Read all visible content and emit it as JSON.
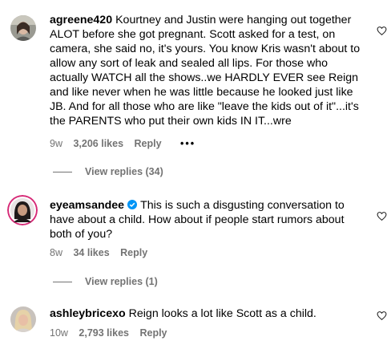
{
  "comments": [
    {
      "username": "agreene420",
      "verified": false,
      "text": "Kourtney and Justin were hanging out together ALOT before she got pregnant. Scott asked for a test, on camera, she said no, it's yours. You know Kris wasn't about to allow any sort of leak and sealed all lips. For those who actually WATCH all the shows..we HARDLY EVER see Reign and like never when he was little because he looked just like JB. And for all those who are like \"leave the kids out of it\"...it's the PARENTS who put their own kids IN IT...wre",
      "time": "9w",
      "likes": "3,206 likes",
      "reply": "Reply",
      "more": "•••",
      "view_replies": "View replies (34)"
    },
    {
      "username": "eyeamsandee",
      "verified": true,
      "text": "This is such a disgusting conversation to have about a child. How about if people start rumors about both of you?",
      "time": "8w",
      "likes": "34 likes",
      "reply": "Reply",
      "view_replies": "View replies (1)"
    },
    {
      "username": "ashleybricexo",
      "verified": false,
      "text": "Reign looks a lot like Scott as a child.",
      "time": "10w",
      "likes": "2,793 likes",
      "reply": "Reply"
    }
  ],
  "icons": {
    "heart": "heart-icon",
    "verified": "verified-badge-icon"
  },
  "colors": {
    "text": "#000000",
    "secondary": "#737373",
    "verified": "#0095f6",
    "story_ring": "#d62976"
  }
}
